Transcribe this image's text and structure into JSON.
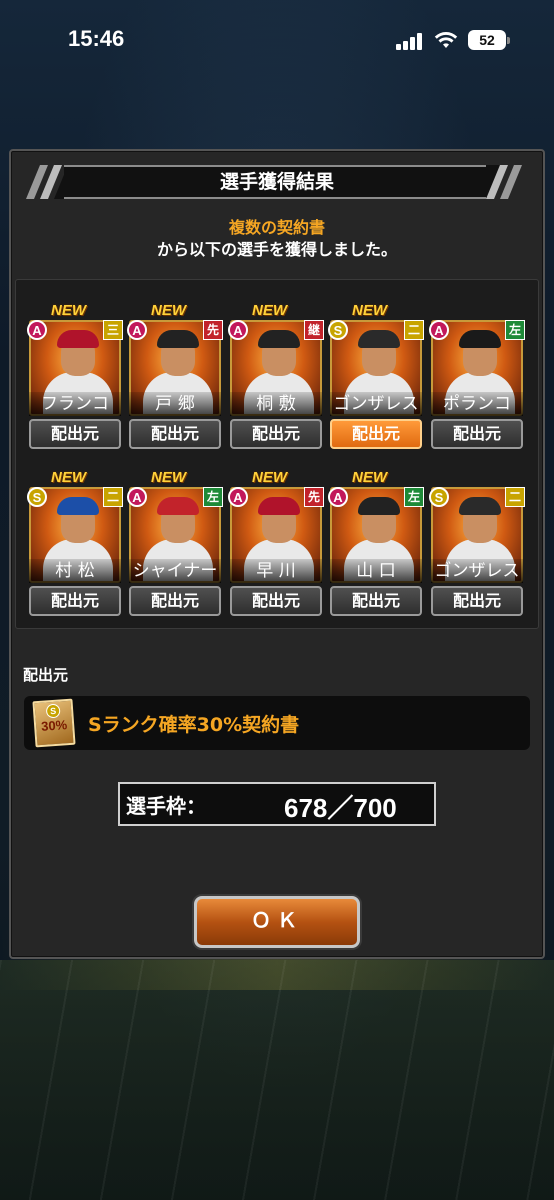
{
  "status_bar": {
    "time": "15:46",
    "battery": "52"
  },
  "dialog": {
    "title": "選手獲得結果",
    "message_highlight": "複数の契約書",
    "message_body": "から以下の選手を獲得しました。",
    "cards": [
      {
        "rank": "A",
        "position": "三",
        "position_color": "yellow",
        "name": "フランコ",
        "new": "NEW",
        "source_button": "配出元",
        "cap_color": "#b0132b",
        "active": false
      },
      {
        "rank": "A",
        "position": "先",
        "position_color": "red",
        "name": "戸 郷",
        "new": "NEW",
        "source_button": "配出元",
        "cap_color": "#222222",
        "active": false
      },
      {
        "rank": "A",
        "position": "継",
        "position_color": "red",
        "name": "桐 敷",
        "new": "NEW",
        "source_button": "配出元",
        "cap_color": "#222222",
        "active": false
      },
      {
        "rank": "S",
        "position": "二",
        "position_color": "yellow",
        "name": "ゴンザレス",
        "new": "NEW",
        "source_button": "配出元",
        "cap_color": "#2a2a2a",
        "active": true
      },
      {
        "rank": "A",
        "position": "左",
        "position_color": "green",
        "name": "ポランコ",
        "new": "",
        "source_button": "配出元",
        "cap_color": "#1a1a1a",
        "active": false
      },
      {
        "rank": "S",
        "position": "二",
        "position_color": "yellow",
        "name": "村 松",
        "new": "NEW",
        "source_button": "配出元",
        "cap_color": "#1c4fa8",
        "active": false
      },
      {
        "rank": "A",
        "position": "左",
        "position_color": "green",
        "name": "シャイナー",
        "new": "NEW",
        "source_button": "配出元",
        "cap_color": "#c2232b",
        "active": false
      },
      {
        "rank": "A",
        "position": "先",
        "position_color": "red",
        "name": "早 川",
        "new": "NEW",
        "source_button": "配出元",
        "cap_color": "#b0132b",
        "active": false
      },
      {
        "rank": "A",
        "position": "左",
        "position_color": "green",
        "name": "山 口",
        "new": "NEW",
        "source_button": "配出元",
        "cap_color": "#222222",
        "active": false
      },
      {
        "rank": "S",
        "position": "二",
        "position_color": "yellow",
        "name": "ゴンザレス",
        "new": "",
        "source_button": "配出元",
        "cap_color": "#2a2a2a",
        "active": false
      }
    ],
    "source_label": "配出元",
    "source_item": {
      "ticket_percent": "30%",
      "ticket_rank": "S",
      "text": "Sランク確率30%契約書"
    },
    "slot": {
      "label": "選手枠：",
      "value": "678／700"
    },
    "ok_button": "ＯＫ"
  }
}
